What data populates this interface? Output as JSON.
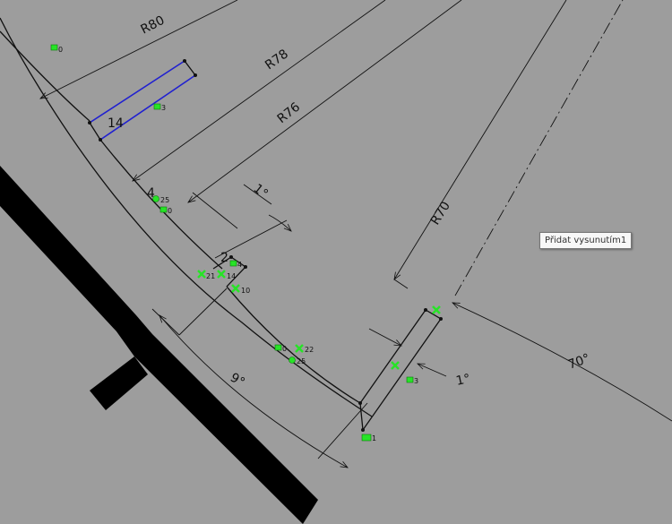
{
  "canvas": {
    "background": "#9d9d9d",
    "geometry_color": "#111111",
    "selected_color": "#2020d0",
    "relation_color": "#27e327"
  },
  "dimensions": {
    "r80": "R80",
    "r78": "R78",
    "r76": "R76",
    "r70": "R70",
    "angle_top": "1°",
    "angle_right": "1°",
    "angle_bottom": "9°",
    "angle_arc": "70°",
    "len_14": "14",
    "len_4": "4",
    "len_2": "2"
  },
  "relations": [
    {
      "id": "rel-0-a",
      "label": "0",
      "icon": "horizontal-relation-icon"
    },
    {
      "id": "rel-3-a",
      "label": "3",
      "icon": "parallel-relation-icon"
    },
    {
      "id": "rel-25-a",
      "label": "25",
      "icon": "tangent-relation-icon"
    },
    {
      "id": "rel-0-b",
      "label": "0",
      "icon": "horizontal-relation-icon"
    },
    {
      "id": "rel-21",
      "label": "21",
      "icon": "coincident-relation-icon"
    },
    {
      "id": "rel-14",
      "label": "14",
      "icon": "coincident-relation-icon"
    },
    {
      "id": "rel-4",
      "label": "4",
      "icon": "horizontal-relation-icon"
    },
    {
      "id": "rel-10",
      "label": "10",
      "icon": "coincident-relation-icon"
    },
    {
      "id": "rel-0-c",
      "label": "0",
      "icon": "horizontal-relation-icon"
    },
    {
      "id": "rel-22",
      "label": "22",
      "icon": "coincident-relation-icon"
    },
    {
      "id": "rel-25-b",
      "label": "25",
      "icon": "tangent-relation-icon"
    },
    {
      "id": "rel-3-b",
      "label": "3",
      "icon": "coincident-relation-icon"
    },
    {
      "id": "rel-1",
      "label": "1",
      "icon": "equal-relation-icon"
    },
    {
      "id": "rel-top",
      "label": "",
      "icon": "coincident-relation-icon"
    }
  ],
  "tooltip": {
    "text": "Přidat vysunutím1"
  }
}
